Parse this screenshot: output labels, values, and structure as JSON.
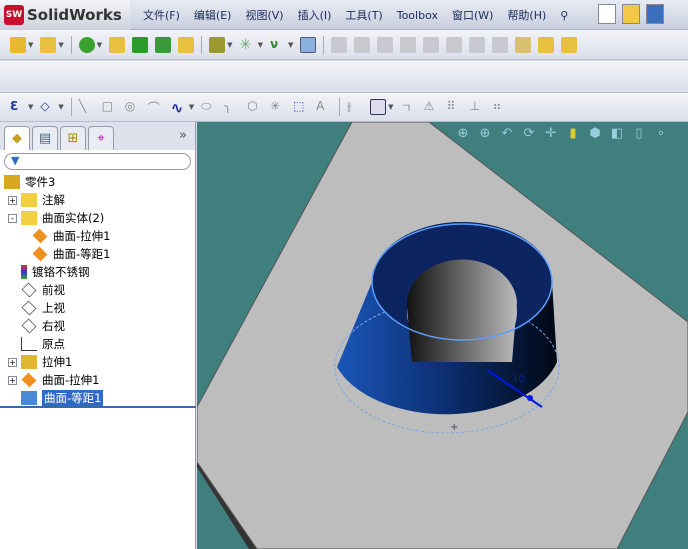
{
  "app": {
    "title": "SolidWorks",
    "logo": "SW"
  },
  "menu": [
    "文件(F)",
    "编辑(E)",
    "视图(V)",
    "插入(I)",
    "工具(T)",
    "Toolbox",
    "窗口(W)",
    "帮助(H)"
  ],
  "panel": {
    "tabs": [
      "feature-manager",
      "property-manager",
      "configuration-manager",
      "dim-xpert-manager"
    ],
    "more": "»",
    "filter_icon": "filter-icon",
    "tree": [
      {
        "label": "零件3",
        "level": 0,
        "icon": "part-icon"
      },
      {
        "label": "注解",
        "level": 1,
        "icon": "annotations-icon",
        "expand": "+"
      },
      {
        "label": "曲面实体(2)",
        "level": 1,
        "icon": "surface-bodies-icon",
        "expand": "-"
      },
      {
        "label": "曲面-拉伸1",
        "level": 2,
        "icon": "surface-icon"
      },
      {
        "label": "曲面-等距1",
        "level": 2,
        "icon": "surface-icon"
      },
      {
        "label": "镀铬不锈钢",
        "level": 1,
        "icon": "material-icon"
      },
      {
        "label": "前视",
        "level": 1,
        "icon": "plane-icon"
      },
      {
        "label": "上视",
        "level": 1,
        "icon": "plane-icon"
      },
      {
        "label": "右视",
        "level": 1,
        "icon": "plane-icon"
      },
      {
        "label": "原点",
        "level": 1,
        "icon": "origin-icon"
      },
      {
        "label": "拉伸1",
        "level": 1,
        "icon": "extrude-icon",
        "expand": "+"
      },
      {
        "label": "曲面-拉伸1",
        "level": 1,
        "icon": "surface-extrude-icon",
        "expand": "+"
      },
      {
        "label": "曲面-等距1",
        "level": 1,
        "icon": "offset-surface-icon",
        "selected": true
      }
    ]
  },
  "viewport": {
    "dimension_label": "10",
    "background": "#3f7f7d",
    "accent": "#1a4fa8"
  }
}
